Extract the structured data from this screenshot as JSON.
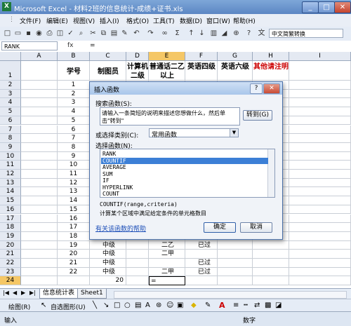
{
  "window": {
    "title": "Microsoft Excel - 材料2班的信息统计-成绩+证书.xls",
    "icon": "X"
  },
  "menu": [
    "文件(F)",
    "编辑(E)",
    "视图(V)",
    "插入(I)",
    "格式(O)",
    "工具(T)",
    "数据(D)",
    "窗口(W)",
    "帮助(H)"
  ],
  "toolbar": {
    "ime_select": "中文简繁转换"
  },
  "formula": {
    "namebox": "RANK",
    "fx_label": "fx",
    "content": "="
  },
  "columns": [
    "A",
    "B",
    "C",
    "D",
    "E",
    "F",
    "G",
    "H",
    "I"
  ],
  "header_row": {
    "B": "学号",
    "C": "制图员",
    "D": "计算机二级",
    "E": "普通话二乙以上",
    "F": "英语四级",
    "G": "英语六级",
    "H": "其他请注明"
  },
  "rows": [
    {
      "n": "2",
      "b": "1"
    },
    {
      "n": "3",
      "b": "2"
    },
    {
      "n": "4",
      "b": "3"
    },
    {
      "n": "5",
      "b": "4"
    },
    {
      "n": "6",
      "b": "5"
    },
    {
      "n": "7",
      "b": "6"
    },
    {
      "n": "8",
      "b": "7"
    },
    {
      "n": "9",
      "b": "8"
    },
    {
      "n": "10",
      "b": "9"
    },
    {
      "n": "11",
      "b": "10"
    },
    {
      "n": "12",
      "b": "11"
    },
    {
      "n": "13",
      "b": "12"
    },
    {
      "n": "14",
      "b": "13"
    },
    {
      "n": "15",
      "b": "14"
    },
    {
      "n": "16",
      "b": "15"
    },
    {
      "n": "17",
      "b": "16"
    },
    {
      "n": "18",
      "b": "17"
    },
    {
      "n": "19",
      "b": "18"
    },
    {
      "n": "20",
      "b": "19",
      "c": "中级",
      "e": "二乙",
      "f": "已过"
    },
    {
      "n": "21",
      "b": "20",
      "c": "中级",
      "e": "二甲"
    },
    {
      "n": "22",
      "b": "21",
      "c": "中级",
      "f": "已过"
    },
    {
      "n": "23",
      "b": "22",
      "c": "中级",
      "e": "二甲",
      "f": "已过"
    },
    {
      "n": "24",
      "b": "",
      "c": "20",
      "e": "="
    }
  ],
  "sheet_tabs": [
    "信息统计表",
    "Sheet1"
  ],
  "drawbar": {
    "draw_label": "绘图(R)",
    "autoshape_label": "自选图形(U)"
  },
  "status": {
    "left": "输入",
    "right": "数字"
  },
  "dialog": {
    "title": "插入函数",
    "search_label": "搜索函数(S):",
    "search_text": "请输入一条简短的说明来描述您想做什么，然后单击\"转到\"",
    "go_button": "转到(G)",
    "category_label": "或选择类别(C):",
    "category_value": "常用函数",
    "select_label": "选择函数(N):",
    "functions": [
      "RANK",
      "COUNTIF",
      "AVERAGE",
      "SUM",
      "IF",
      "HYPERLINK",
      "COUNT"
    ],
    "selected_function": "COUNTIF",
    "syntax": "COUNTIF(range,criteria)",
    "description": "计算某个区域中满足给定条件的单元格数目",
    "help_link": "有关该函数的帮助",
    "ok_button": "确定",
    "cancel_button": "取消"
  },
  "colors": {
    "accent_red": "#cc0000",
    "selection": "#3c7fd6"
  }
}
